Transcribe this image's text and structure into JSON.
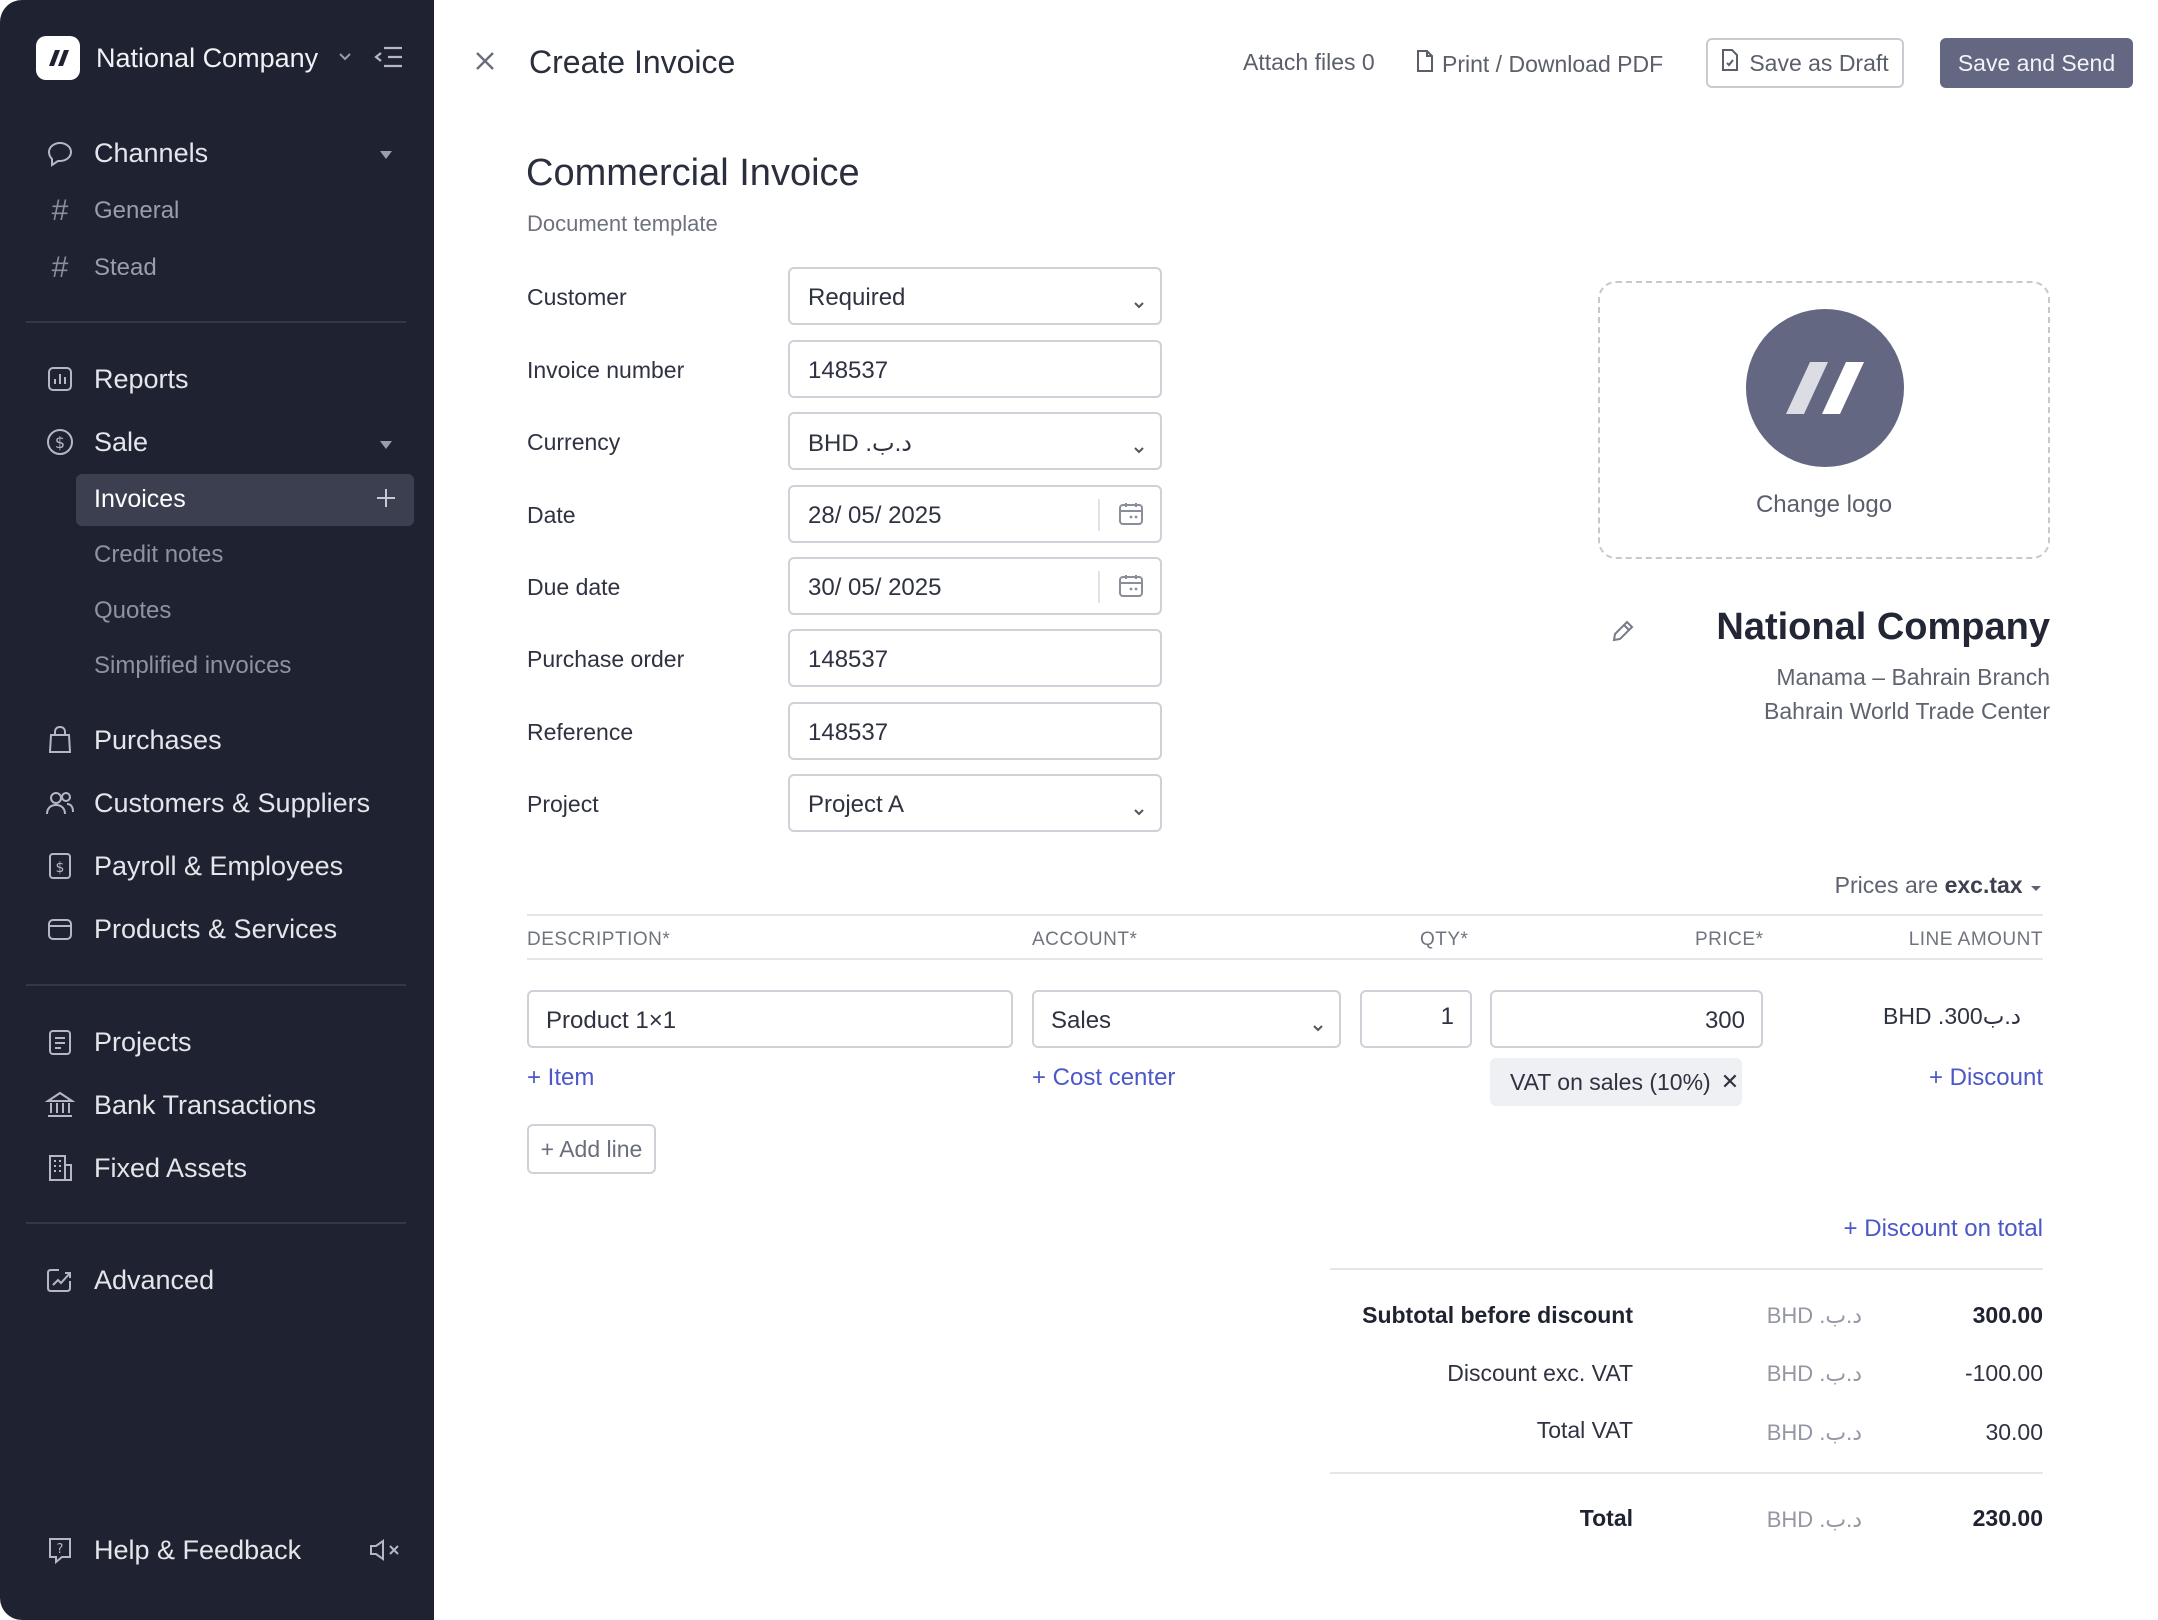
{
  "sidebar": {
    "company": "National Company",
    "channels": {
      "label": "Channels",
      "items": [
        "General",
        "Stead"
      ]
    },
    "reports": "Reports",
    "sale": {
      "label": "Sale",
      "active": "Invoices",
      "items": [
        "Credit notes",
        "Quotes",
        "Simplified invoices"
      ]
    },
    "nav": [
      "Purchases",
      "Customers & Suppliers",
      "Payroll & Employees",
      "Products & Services"
    ],
    "nav2": [
      "Projects",
      "Bank Transactions",
      "Fixed Assets"
    ],
    "advanced": "Advanced",
    "help": "Help & Feedback"
  },
  "header": {
    "title": "Create Invoice",
    "attach": "Attach files 0",
    "print": "Print / Download PDF",
    "draft": "Save as Draft",
    "send": "Save and Send"
  },
  "document": {
    "title": "Commercial Invoice",
    "subtitle": "Document template"
  },
  "form": {
    "customer": {
      "label": "Customer",
      "value": "Required"
    },
    "invoice_number": {
      "label": "Invoice number",
      "value": "148537"
    },
    "currency": {
      "label": "Currency",
      "value": "BHD .د.ب"
    },
    "date": {
      "label": "Date",
      "value": "28/ 05/ 2025"
    },
    "due_date": {
      "label": "Due date",
      "value": "30/ 05/ 2025"
    },
    "purchase_order": {
      "label": "Purchase order",
      "value": "148537"
    },
    "reference": {
      "label": "Reference",
      "value": "148537"
    },
    "project": {
      "label": "Project",
      "value": "Project A"
    }
  },
  "company": {
    "change_logo": "Change logo",
    "name": "National Company",
    "address1": "Manama – Bahrain Branch",
    "address2": "Bahrain World Trade Center"
  },
  "lines": {
    "prices_prefix": "Prices are",
    "prices_mode": "exc.tax",
    "headers": {
      "description": "DESCRIPTION*",
      "account": "ACCOUNT*",
      "qty": "QTY*",
      "price": "PRICE*",
      "amount": "LINE AMOUNT"
    },
    "row": {
      "description": "Product 1×1",
      "account": "Sales",
      "qty": "1",
      "price": "300",
      "currency": "BHD .د.ب",
      "amount": "300",
      "tax": "VAT on sales (10%)",
      "tax_remove": "✕"
    },
    "add_item": "+ Item",
    "add_cost_center": "+ Cost center",
    "add_discount": "+ Discount",
    "add_line": "+ Add line",
    "discount_total": "+ Discount on total"
  },
  "totals": {
    "currency": "BHD .د.ب",
    "subtotal_label": "Subtotal before discount",
    "subtotal": "300.00",
    "discount_label": "Discount exc. VAT",
    "discount": "-100.00",
    "vat_label": "Total VAT",
    "vat": "30.00",
    "total_label": "Total",
    "total": "230.00"
  },
  "colors": {
    "sidebar_bg": "#1f2230",
    "accent": "#646782",
    "link": "#4c57c9"
  }
}
